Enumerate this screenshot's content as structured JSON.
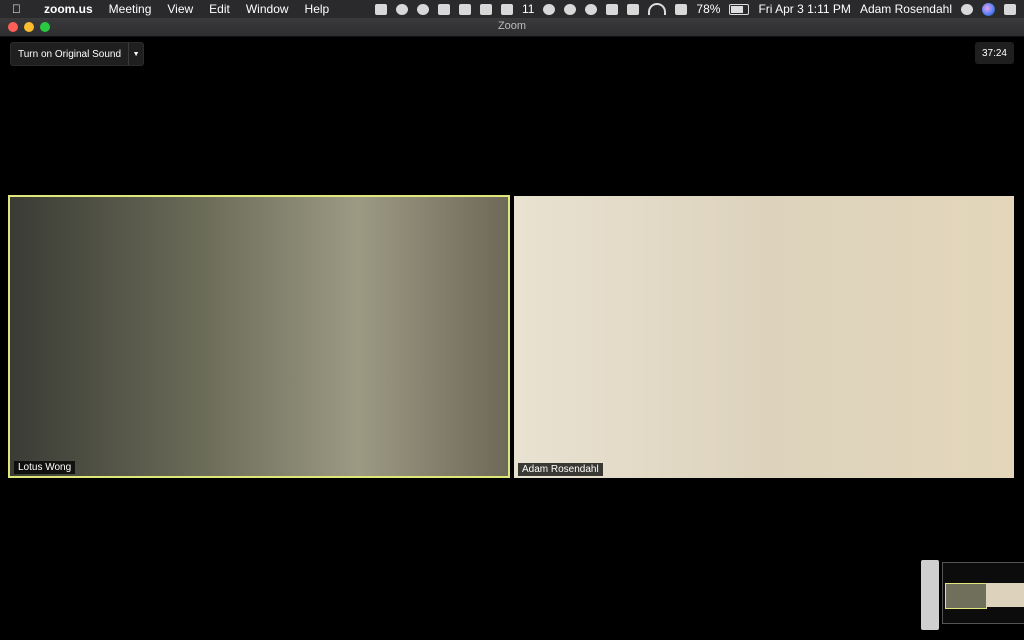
{
  "menubar": {
    "app_name": "zoom.us",
    "menus": [
      "Meeting",
      "View",
      "Edit",
      "Window",
      "Help"
    ],
    "status_number": "11",
    "battery": "78%",
    "datetime": "Fri Apr 3  1:11 PM",
    "user": "Adam Rosendahl"
  },
  "window": {
    "title": "Zoom"
  },
  "controls": {
    "sound_button": "Turn on Original Sound",
    "timer": "37:24"
  },
  "participants": [
    {
      "name": "Lotus Wong",
      "active_speaker": true
    },
    {
      "name": "Adam Rosendahl",
      "active_speaker": false
    }
  ],
  "colors": {
    "active_speaker_border": "#dfe67a",
    "background": "#000000"
  }
}
